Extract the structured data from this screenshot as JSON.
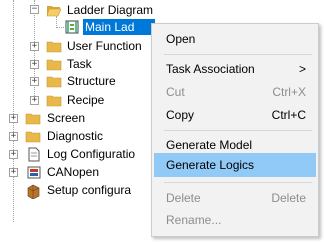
{
  "tree": {
    "items": [
      {
        "label": "Ladder Diagram",
        "icon": "folder-open-icon"
      },
      {
        "label": "Main Lad",
        "icon": "ladder-program-icon",
        "selected": true
      },
      {
        "label": "User Function",
        "icon": "folder-icon"
      },
      {
        "label": "Task",
        "icon": "folder-icon"
      },
      {
        "label": "Structure",
        "icon": "folder-icon"
      },
      {
        "label": "Recipe",
        "icon": "folder-icon"
      },
      {
        "label": "Screen",
        "icon": "folder-icon"
      },
      {
        "label": "Diagnostic",
        "icon": "folder-icon"
      },
      {
        "label": "Log Configuratio",
        "icon": "document-icon"
      },
      {
        "label": "CANopen",
        "icon": "canopen-icon"
      },
      {
        "label": "Setup configura",
        "icon": "setup-icon"
      }
    ]
  },
  "context_menu": {
    "items": [
      {
        "label": "Open",
        "shortcut": "",
        "disabled": false
      },
      {
        "label": "Task Association",
        "shortcut": "",
        "submenu_arrow": ">",
        "disabled": false
      },
      {
        "label": "Cut",
        "shortcut": "Ctrl+X",
        "disabled": true
      },
      {
        "label": "Copy",
        "shortcut": "Ctrl+C",
        "disabled": false
      },
      {
        "label": "Generate Model",
        "shortcut": "",
        "disabled": false
      },
      {
        "label": "Generate Logics",
        "shortcut": "",
        "disabled": false,
        "highlighted": true
      },
      {
        "label": "Delete",
        "shortcut": "Delete",
        "disabled": true
      },
      {
        "label": "Rename...",
        "shortcut": "",
        "disabled": true
      }
    ]
  },
  "colors": {
    "selection": "#0078d7",
    "menu_highlight": "#91c9f7",
    "folder": "#e8b84a"
  }
}
